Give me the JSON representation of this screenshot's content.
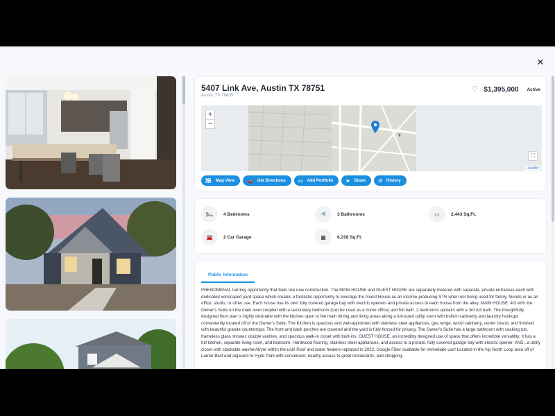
{
  "listing": {
    "address": "5407 Link Ave, Austin TX 78751",
    "sub_address": "Austin, TX 78435",
    "price": "$1,395,000",
    "status": "Active"
  },
  "map": {
    "zoom_in": "+",
    "zoom_out": "−",
    "attribution": "Leaflet"
  },
  "actions": [
    {
      "label": "Map View",
      "icon": "map-icon"
    },
    {
      "label": "Get Directions",
      "icon": "car-icon"
    },
    {
      "label": "Add Portfolio",
      "icon": "folder-icon"
    },
    {
      "label": "Share",
      "icon": "share-icon"
    },
    {
      "label": "History",
      "icon": "history-icon"
    }
  ],
  "features": [
    {
      "label": "4 Bedrooms",
      "icon": "bed-icon"
    },
    {
      "label": "3 Bathrooms",
      "icon": "shower-icon"
    },
    {
      "label": "2,443 Sq.Ft.",
      "icon": "ruler-icon"
    },
    {
      "label": "2 Car Garage",
      "icon": "car-icon"
    },
    {
      "label": "6,316 Sq.Ft.",
      "icon": "lot-icon"
    }
  ],
  "info": {
    "tab_label": "Public Information",
    "description": "PHENOMENAL turnkey opportunity that feels like new construction. The MAIN HOUSE and GUEST HOUSE are separately metered with separate, private entrances each with dedicated xeriscaped yard space which creates a fantastic opportunity to leverage the Guest House as an income-producing STR when not being used for family, friends or as an office, studio, or other use. Each house has its own fully covered garage bay with electric openers and private access to each house from the alley. MAIN HOUSE: 4/3 with the Owner's Suite on the main level coupled with a secondary bedroom (can be used as a home office) and full bath. 2 bedrooms upstairs with a 3rd full bath. The thoughtfully designed floor plan is highly desirable with the kitchen open to the main dining and living areas along a full-sized utility room with built-in cabinetry and laundry hookups conveniently located off of the Owner's Suite. The Kitchen is spacious and well-appointed with stainless steel appliances, gas range, wood cabinetry, center island, and finished with beautiful granite countertops. The front and back porches are covered and the yard is fully fenced for privacy. The Owner's Suite has a large bathroom with soaking tub, frameless glass shower, double vanities, and spacious walk-in closet with built-ins. GUEST HOUSE: an incredibly designed use of space that offers incredible versatility. It has a full kitchen, separate living room, and bedroom. Hardwood flooring, stainless steel appliances, and access to a private, fully-covered garage bay with electric opener. AND...a utility closet with stackable washer/dryer within the unit! Roof and water heaters replaced in 2022. Google Fiber available for immediate use! Located in the hip North Loop area off of Lamar Blvd and adjacent to Hyde Park with convenient, nearby access to great restaurants, and shopping."
  },
  "colors": {
    "accent": "#1a8fe0",
    "heart": "#e04b56"
  },
  "close_label": "✕"
}
